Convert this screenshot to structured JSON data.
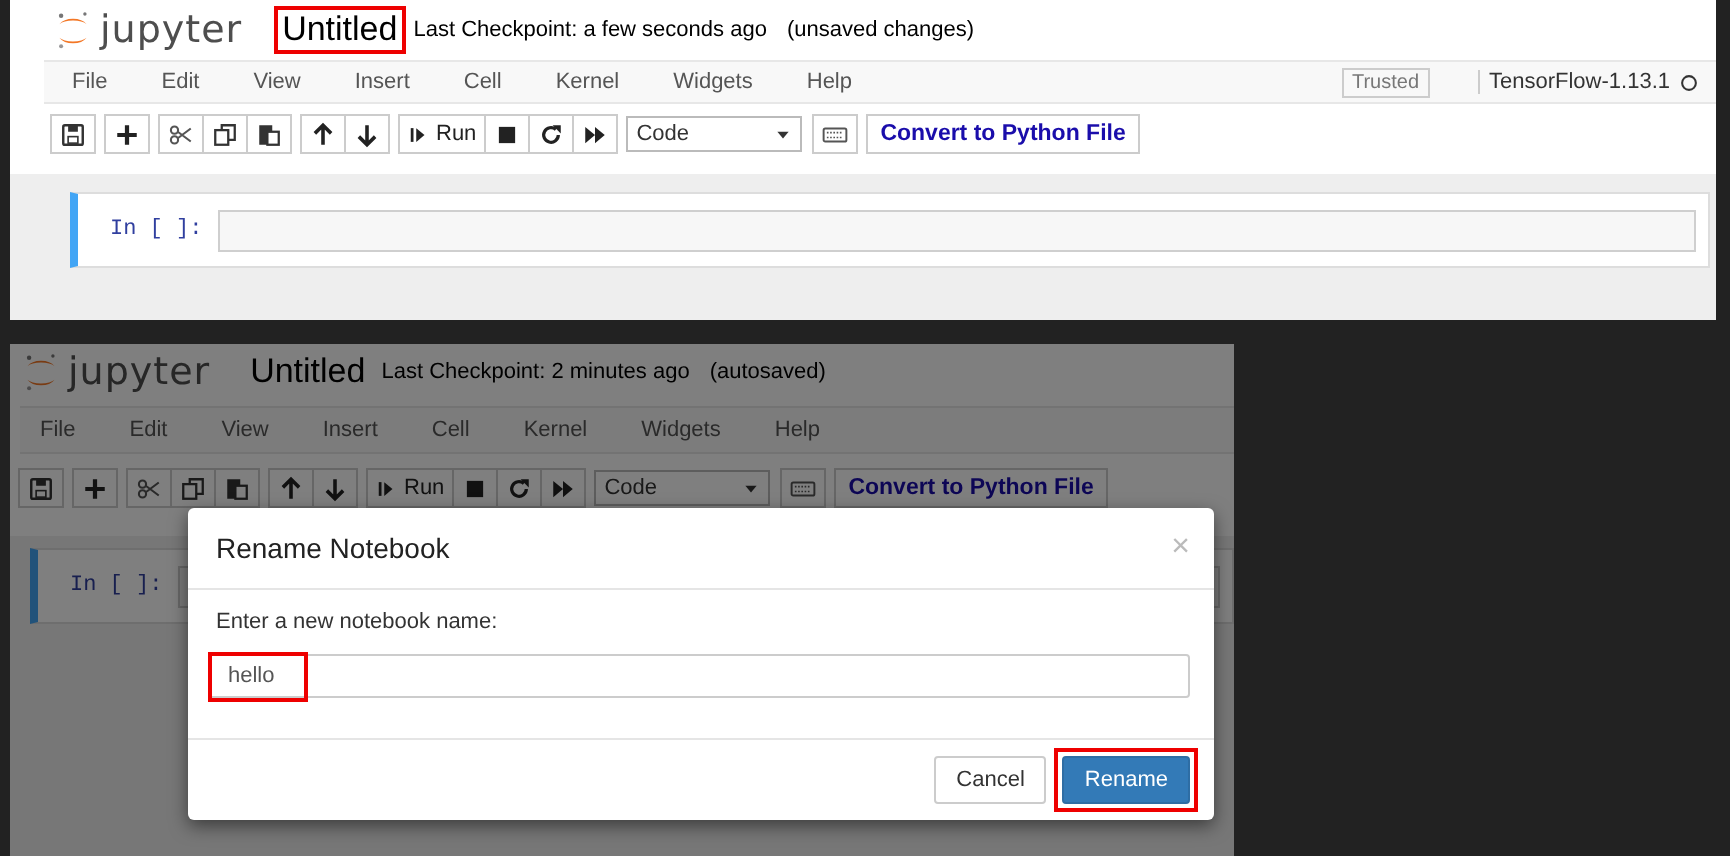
{
  "panels": [
    {
      "logo_text": "jupyter",
      "title": "Untitled",
      "title_highlighted": true,
      "checkpoint": "Last Checkpoint: a few seconds ago",
      "save_status": "(unsaved changes)",
      "menu": [
        "File",
        "Edit",
        "View",
        "Insert",
        "Cell",
        "Kernel",
        "Widgets",
        "Help"
      ],
      "trusted": "Trusted",
      "kernel": "TensorFlow-1.13.1",
      "run_label": "Run",
      "cell_type": "Code",
      "convert_label": "Convert to Python File",
      "cell_prompt": "In [ ]:"
    },
    {
      "logo_text": "jupyter",
      "title": "Untitled",
      "title_highlighted": false,
      "checkpoint": "Last Checkpoint: 2 minutes ago",
      "save_status": "(autosaved)",
      "menu": [
        "File",
        "Edit",
        "View",
        "Insert",
        "Cell",
        "Kernel",
        "Widgets",
        "Help"
      ],
      "run_label": "Run",
      "cell_type": "Code",
      "convert_label": "Convert to Python File",
      "cell_prompt": "In [ ]:",
      "dialog": {
        "title": "Rename Notebook",
        "close": "×",
        "label": "Enter a new notebook name:",
        "value": "hello",
        "value_highlighted": true,
        "buttons": [
          {
            "label": "Cancel",
            "primary": false,
            "highlighted": false
          },
          {
            "label": "Rename",
            "primary": true,
            "highlighted": true
          }
        ]
      }
    }
  ]
}
